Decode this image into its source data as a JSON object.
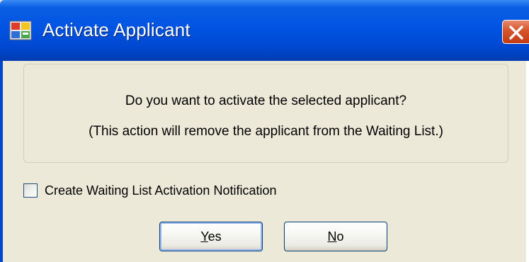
{
  "window": {
    "title": "Activate Applicant",
    "icon": "application-icon",
    "close_icon": "close-icon",
    "close_color": "#d5542c",
    "titlebar_color": "#0054e3"
  },
  "message": {
    "line1": "Do you want to activate the selected applicant?",
    "line2": "(This action will remove the applicant from the Waiting List.)"
  },
  "notification_checkbox": {
    "label": "Create Waiting List Activation Notification",
    "checked": false
  },
  "buttons": {
    "yes": {
      "mnemonic": "Y",
      "rest": "es"
    },
    "no": {
      "mnemonic": "N",
      "rest": "o"
    }
  }
}
